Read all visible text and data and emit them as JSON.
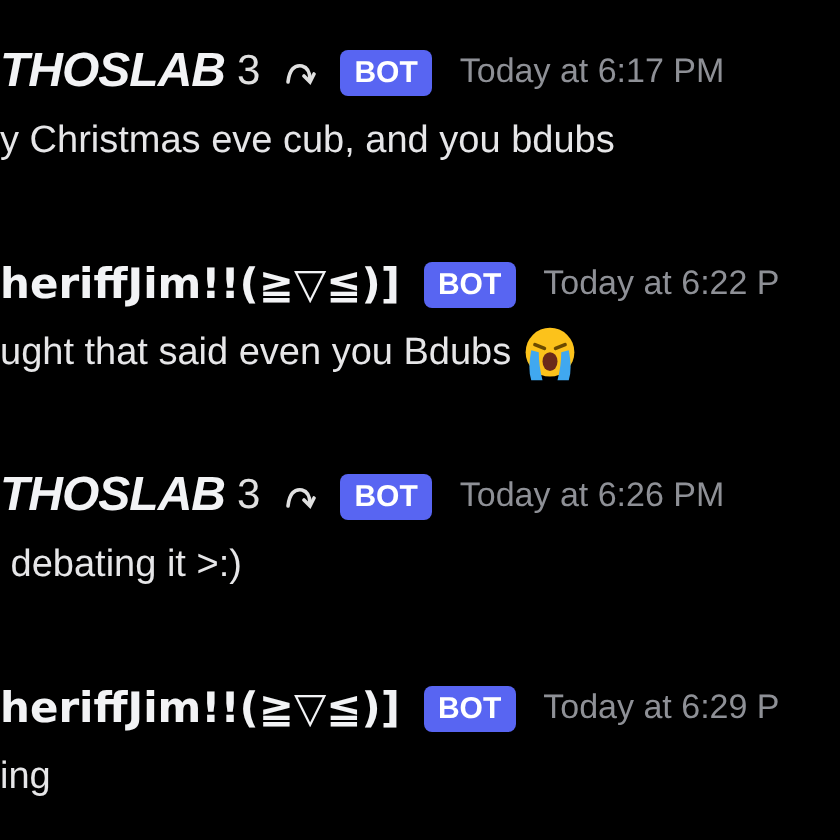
{
  "messages": [
    {
      "kind": "styled",
      "author": "THOSLAB",
      "author_suffix": "3",
      "badge": "BOT",
      "timestamp": "Today at 6:17 PM",
      "text": "y Christmas eve cub, and you bdubs"
    },
    {
      "kind": "plain",
      "author": "heriffJim!!(≧▽≦)]",
      "badge": "BOT",
      "timestamp": "Today at 6:22 P",
      "text": "ught that said even you Bdubs",
      "emoji": true
    },
    {
      "kind": "styled",
      "author": "THOSLAB",
      "author_suffix": "3",
      "badge": "BOT",
      "timestamp": "Today at 6:26 PM",
      "text": " debating it >:)"
    },
    {
      "kind": "plain",
      "author": "heriffJim!!(≧▽≦)]",
      "badge": "BOT",
      "timestamp": "Today at 6:29 P",
      "text": "ing"
    }
  ]
}
